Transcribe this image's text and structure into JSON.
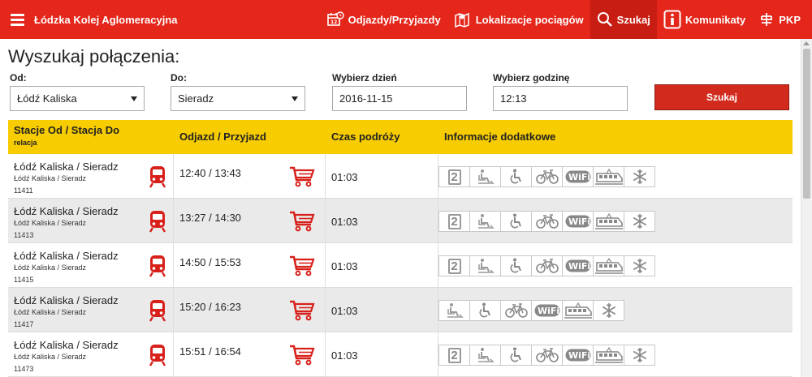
{
  "header": {
    "brand": "Łódzka Kolej Aglomeracyjna",
    "nav": [
      {
        "label": "Odjazdy/Przyjazdy",
        "icon": "calendar-icon"
      },
      {
        "label": "Lokalizacje pociągów",
        "icon": "map-icon"
      },
      {
        "label": "Szukaj",
        "icon": "search-icon"
      },
      {
        "label": "Komunikaty",
        "icon": "info-icon"
      },
      {
        "label": "PKP",
        "icon": "pkp-logo-icon"
      }
    ]
  },
  "page": {
    "title": "Wyszukaj połączenia:"
  },
  "form": {
    "from_label": "Od:",
    "from_value": "Łódź Kaliska",
    "to_label": "Do:",
    "to_value": "Sieradz",
    "day_label": "Wybierz dzień",
    "day_value": "2016-11-15",
    "time_label": "Wybierz godzinę",
    "time_value": "12:13",
    "search_label": "Szukaj"
  },
  "table": {
    "headers": {
      "stations": "Stacje Od / Stacja Do",
      "relation": "relacja",
      "times": "Odjazd / Przyjazd",
      "duration": "Czas podróży",
      "info": "Informacje dodatkowe"
    },
    "rows": [
      {
        "route": "Łódź Kaliska / Sieradz",
        "relation": "Łódź Kaliska / Sieradz",
        "number": "11411",
        "times": "12:40 / 13:43",
        "duration": "01:03",
        "amenities": [
          "2",
          "seat-reservation-icon",
          "wheelchair-icon",
          "bicycle-icon",
          "wifi-icon",
          "train-car-icon",
          "air-conditioning-icon"
        ]
      },
      {
        "route": "Łódź Kaliska / Sieradz",
        "relation": "Łódź Kaliska / Sieradz",
        "number": "11413",
        "times": "13:27 / 14:30",
        "duration": "01:03",
        "amenities": [
          "2",
          "seat-reservation-icon",
          "wheelchair-icon",
          "bicycle-icon",
          "wifi-icon",
          "train-car-icon",
          "air-conditioning-icon"
        ]
      },
      {
        "route": "Łódź Kaliska / Sieradz",
        "relation": "Łódź Kaliska / Sieradz",
        "number": "11415",
        "times": "14:50 / 15:53",
        "duration": "01:03",
        "amenities": [
          "2",
          "seat-reservation-icon",
          "wheelchair-icon",
          "bicycle-icon",
          "wifi-icon",
          "train-car-icon",
          "air-conditioning-icon"
        ]
      },
      {
        "route": "Łódź Kaliska / Sieradz",
        "relation": "Łódź Kaliska / Sieradz",
        "number": "11417",
        "times": "15:20 / 16:23",
        "duration": "01:03",
        "amenities": [
          "seat-reservation-icon",
          "wheelchair-icon",
          "bicycle-icon",
          "wifi-icon",
          "train-car-icon",
          "air-conditioning-icon"
        ]
      },
      {
        "route": "Łódź Kaliska / Sieradz",
        "relation": "Łódź Kaliska / Sieradz",
        "number": "11473",
        "times": "15:51 / 16:54",
        "duration": "01:03",
        "amenities": [
          "2",
          "seat-reservation-icon",
          "wheelchair-icon",
          "bicycle-icon",
          "wifi-icon",
          "train-car-icon",
          "air-conditioning-icon"
        ]
      }
    ]
  },
  "colors": {
    "brand_red": "#e4261b",
    "header_yellow": "#f7cc00",
    "icon_red": "#d8201a"
  }
}
